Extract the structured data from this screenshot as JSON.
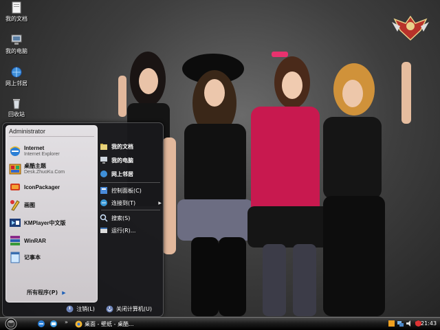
{
  "desktop": {
    "icons": [
      {
        "label": "我的文档",
        "icon": "my-documents-icon"
      },
      {
        "label": "我的电脑",
        "icon": "my-computer-icon"
      },
      {
        "label": "网上邻居",
        "icon": "network-places-icon"
      },
      {
        "label": "回收站",
        "icon": "recycle-bin-icon"
      }
    ]
  },
  "start_menu": {
    "user_name": "Administrator",
    "programs": [
      {
        "name": "Internet",
        "subtitle": "Internet Explorer",
        "icon": "internet-explorer-icon"
      },
      {
        "name": "桌酷主题",
        "subtitle": "Desk.ZhuoKu.Com",
        "icon": "theme-app-icon"
      },
      {
        "name": "IconPackager",
        "subtitle": "",
        "icon": "iconpackager-icon"
      },
      {
        "name": "画图",
        "subtitle": "",
        "icon": "paint-icon"
      },
      {
        "name": "KMPlayer中文版",
        "subtitle": "",
        "icon": "kmplayer-icon"
      },
      {
        "name": "WinRAR",
        "subtitle": "",
        "icon": "winrar-icon"
      },
      {
        "name": "记事本",
        "subtitle": "",
        "icon": "notepad-icon"
      }
    ],
    "all_programs_label": "所有程序(P)",
    "right_items": [
      {
        "label": "我的文档",
        "icon": "folder-icon",
        "bold": true
      },
      {
        "label": "我的电脑",
        "icon": "computer-icon",
        "bold": true
      },
      {
        "label": "网上邻居",
        "icon": "network-icon",
        "bold": true
      },
      {
        "label": "控制面板(C)",
        "icon": "control-panel-icon",
        "bold": false
      },
      {
        "label": "连接到(T)",
        "icon": "connect-icon",
        "bold": false,
        "submenu": true
      },
      {
        "label": "搜索(S)",
        "icon": "search-icon",
        "bold": false
      },
      {
        "label": "运行(R)...",
        "icon": "run-icon",
        "bold": false
      }
    ],
    "logoff_label": "注销(L)",
    "shutdown_label": "关闭计算机(U)"
  },
  "taskbar": {
    "task_label": "桌面 - 壁纸 - 桌酷...",
    "quick_launch_more": "»",
    "clock": "21:43"
  },
  "colors": {
    "accent_blue": "#1d5fb8",
    "taskbar_dark": "#000000"
  }
}
